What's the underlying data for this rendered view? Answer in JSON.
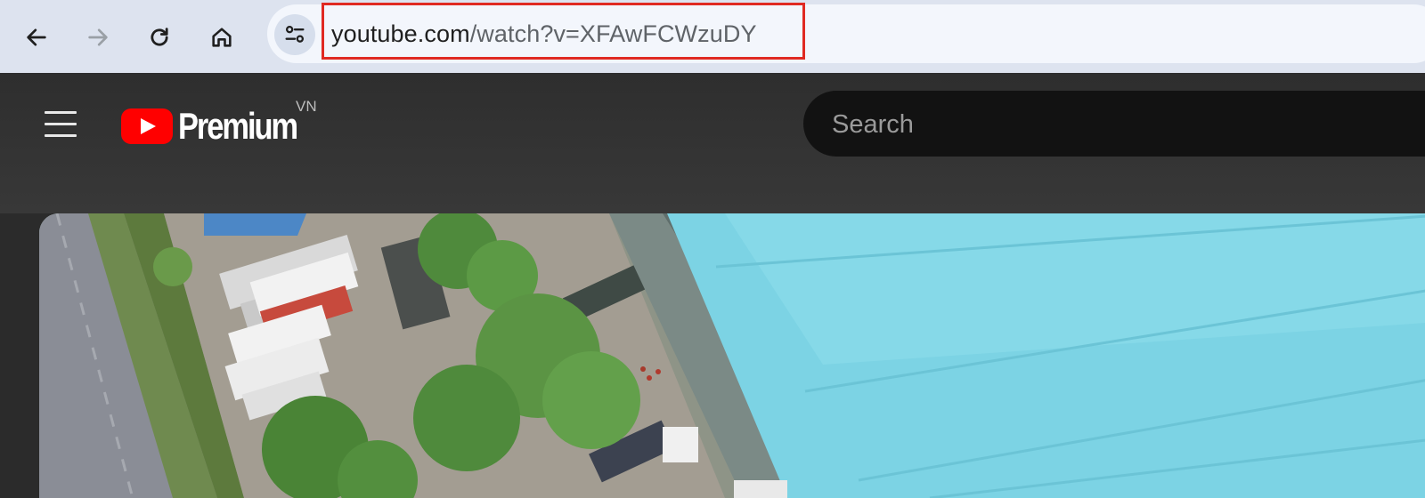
{
  "browser": {
    "url_host": "youtube.com",
    "url_path": "/watch?v=XFAwFCWzuDY",
    "icons": {
      "back": "arrow-left-icon",
      "forward": "arrow-right-icon",
      "reload": "reload-icon",
      "home": "home-icon",
      "site_info": "tune-icon"
    },
    "highlight_color": "#e02a22"
  },
  "youtube": {
    "logo_text": "Premium",
    "region": "VN",
    "search_placeholder": "Search",
    "brand_color": "#ff0000"
  }
}
